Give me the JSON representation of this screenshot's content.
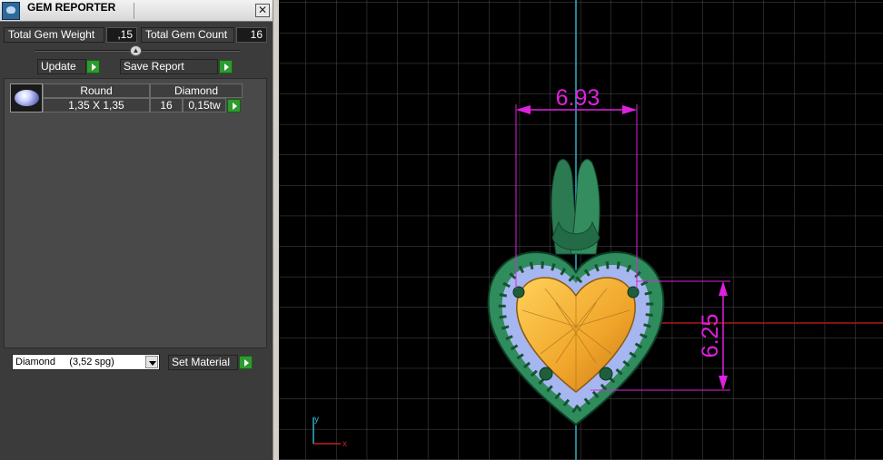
{
  "panel": {
    "title": "GEM REPORTER",
    "close_glyph": "✕",
    "total_weight_label": "Total Gem Weight",
    "total_weight_value": ",15",
    "total_count_label": "Total Gem Count",
    "total_count_value": "16",
    "update_label": "Update",
    "save_report_label": "Save Report",
    "gem_row": {
      "shape": "Round",
      "material": "Diamond",
      "size": "1,35 X 1,35",
      "count": "16",
      "weight": "0,15tw"
    },
    "material_select": "Diamond     (3,52 spg)",
    "set_material_label": "Set Material"
  },
  "viewport": {
    "dim_width": "6.93",
    "dim_height": "6.25",
    "axis_y_label": "y",
    "axis_x_label": "x",
    "colors": {
      "dimension": "#e020e0",
      "grid": "#5a5a5a",
      "metal": "#2e8a5c",
      "center_stone": "#f2b43a",
      "halo_stones": "#a9b8f2",
      "y_axis": "#2fb3c8",
      "x_axis": "#c02020"
    }
  }
}
